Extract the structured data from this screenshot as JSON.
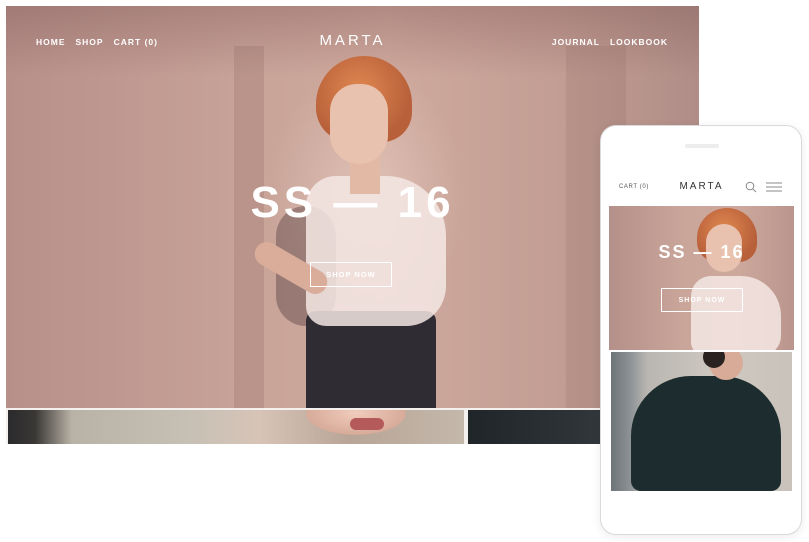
{
  "desktop": {
    "nav_left": [
      {
        "label": "HOME"
      },
      {
        "label": "SHOP"
      },
      {
        "label": "CART (0)"
      }
    ],
    "brand": "MARTA",
    "nav_right": [
      {
        "label": "JOURNAL"
      },
      {
        "label": "LOOKBOOK"
      }
    ],
    "hero_title": "SS — 16",
    "hero_button": "SHOP NOW"
  },
  "mobile": {
    "cart": "CART (0)",
    "brand": "MARTA",
    "hero_title": "SS — 16",
    "hero_button": "SHOP NOW",
    "icons": {
      "search": "search-icon",
      "menu": "hamburger-menu-icon"
    }
  },
  "colors": {
    "hero_tint": "#c8a398",
    "text_on_hero": "#ffffff",
    "mobile_brand": "#333333"
  }
}
